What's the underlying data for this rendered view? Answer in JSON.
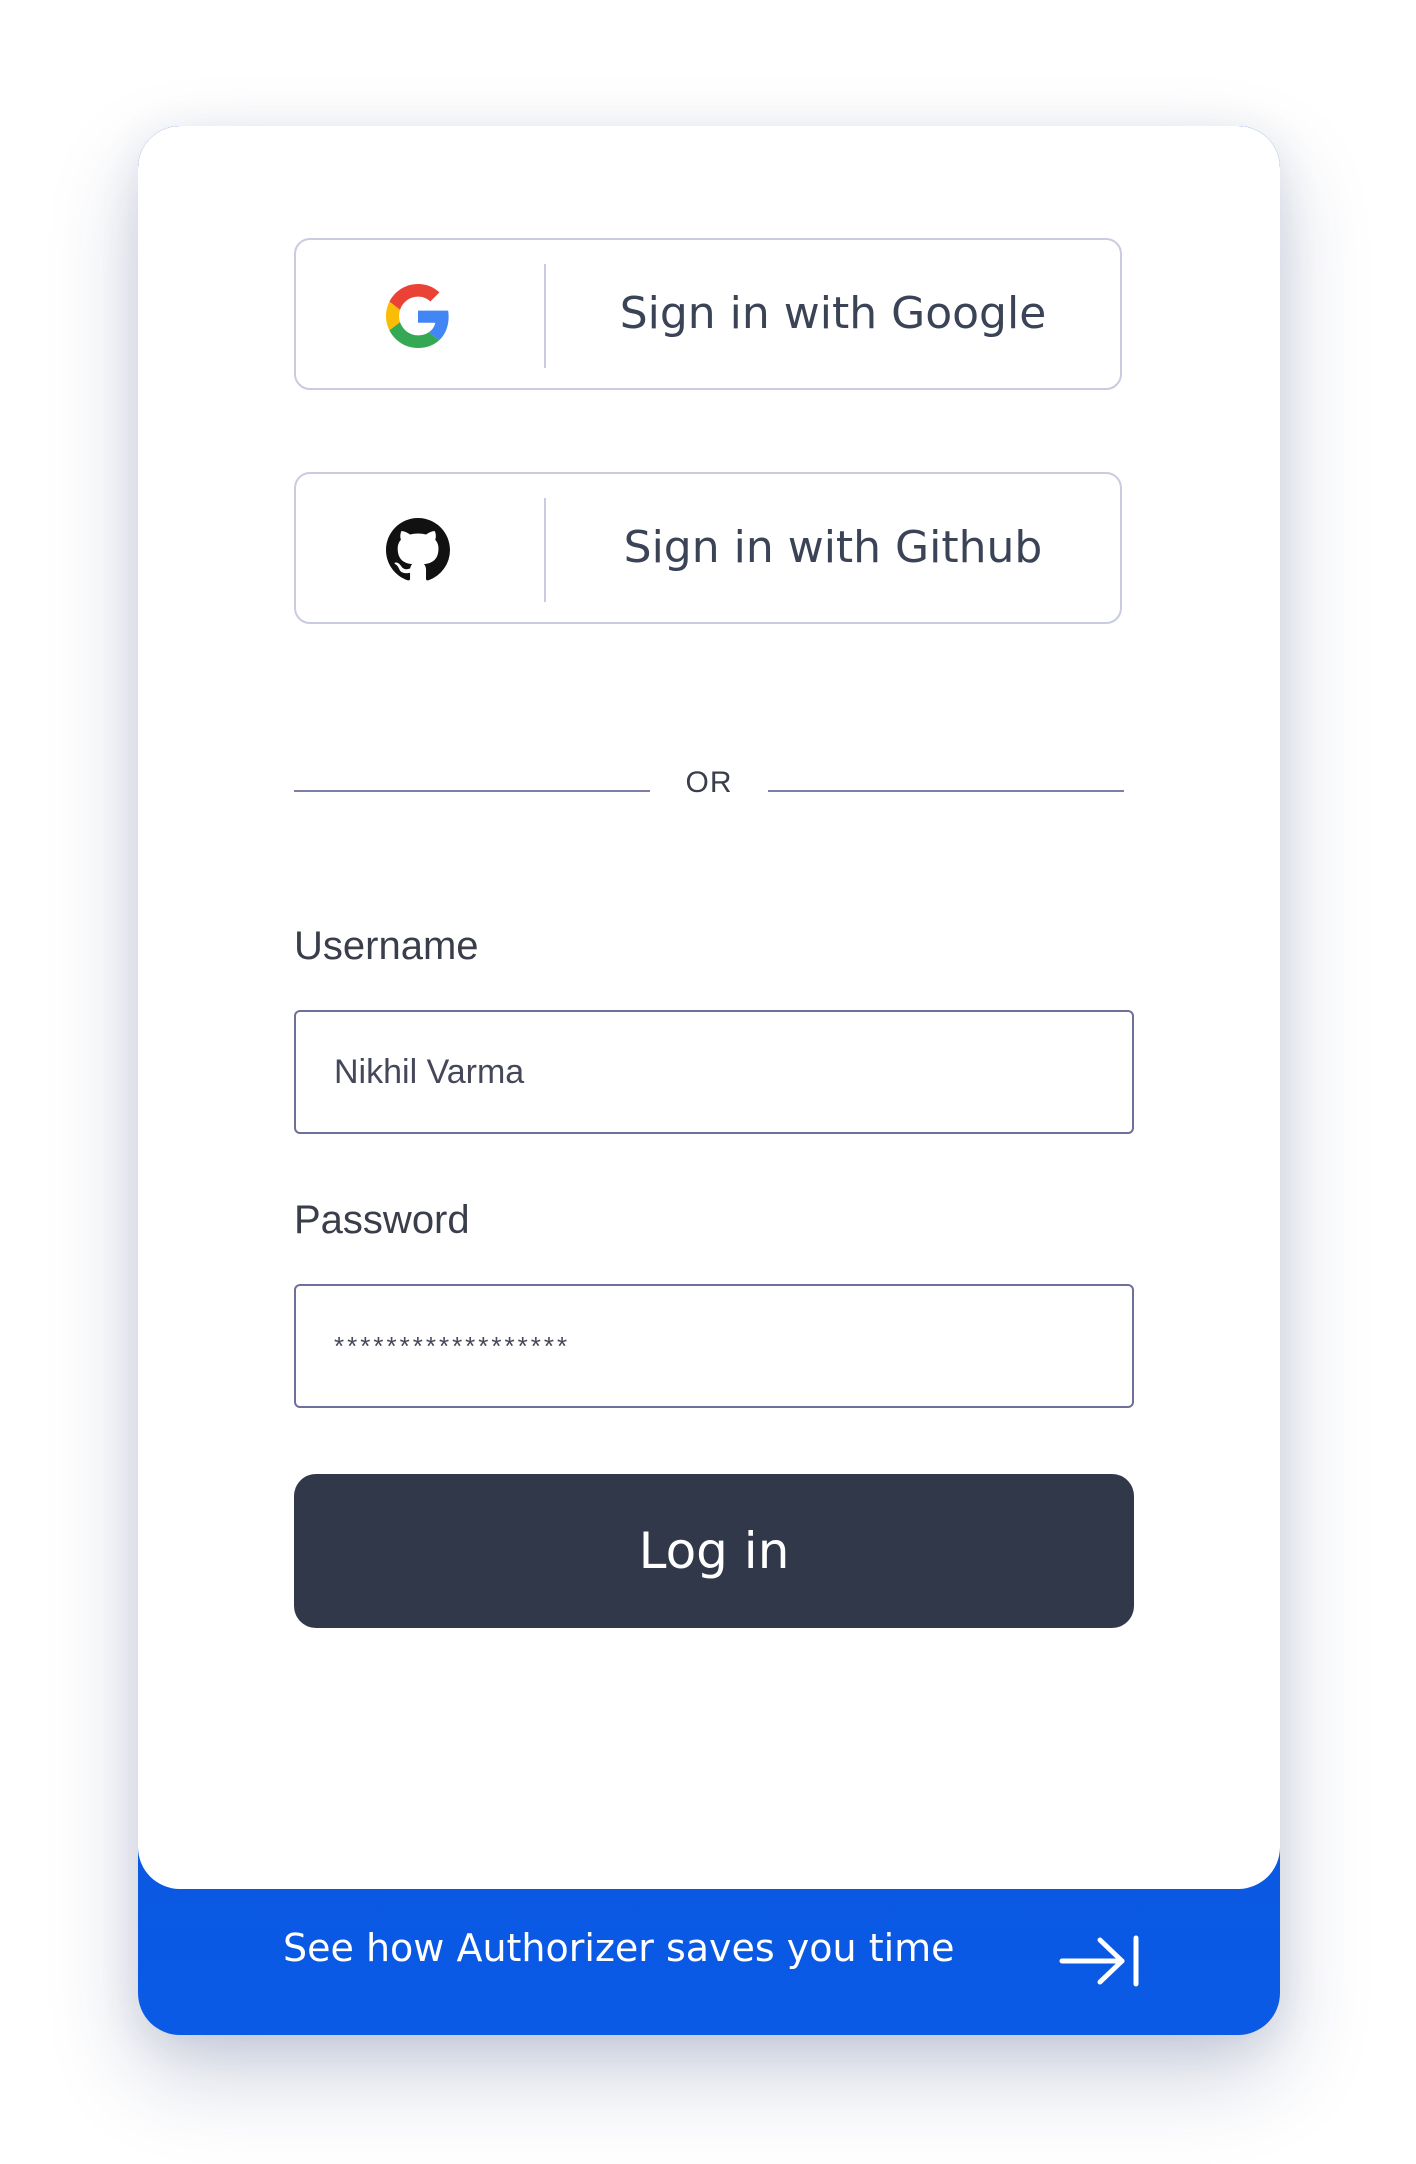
{
  "oauth": {
    "google_label": "Sign in with Google",
    "github_label": "Sign in with Github",
    "google_icon": "google-g-icon",
    "github_icon": "github-octocat-icon"
  },
  "divider": {
    "text": "OR"
  },
  "form": {
    "username_label": "Username",
    "username_value": "Nikhil Varma",
    "password_label": "Password",
    "password_value": "******************",
    "login_label": "Log in"
  },
  "footer": {
    "text": "See how Authorizer saves you time",
    "icon": "arrow-right-to-bar-icon"
  },
  "colors": {
    "primary_button": "#303849",
    "footer_gradient_start": "#1447bd",
    "footer_gradient_end": "#0a5ae6",
    "border": "#c9cbe0",
    "input_border": "#6e6f9c"
  }
}
